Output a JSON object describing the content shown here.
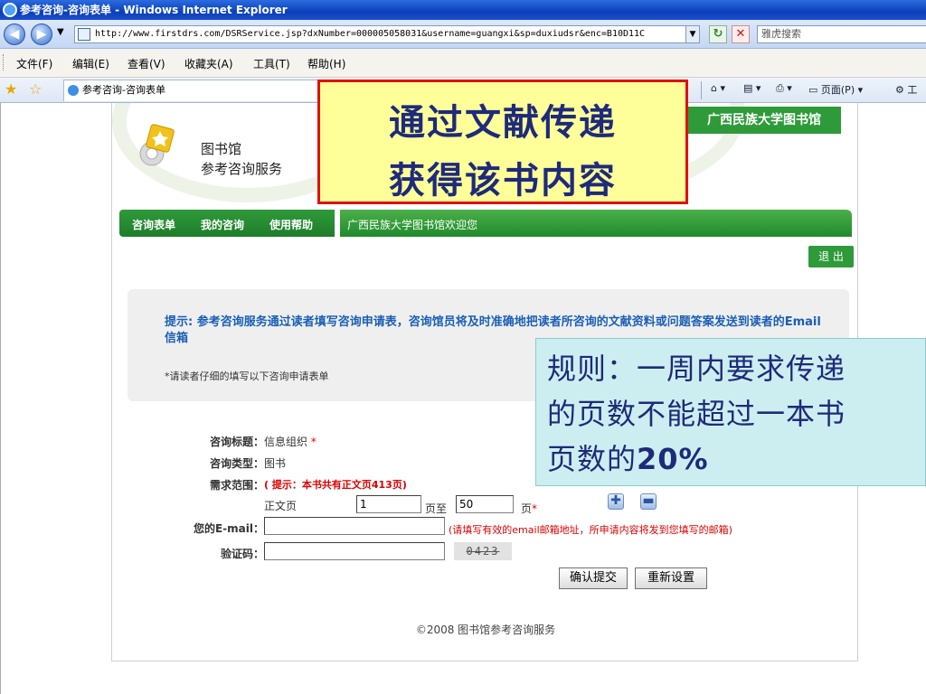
{
  "browser": {
    "window_title": "参考咨询-咨询表单 - Windows Internet Explorer",
    "url": "http://www.firstdrs.com/DSRService.jsp?dxNumber=000005058031&username=guangxi&sp=duxiudsr&enc=B10D11C",
    "search_placeholder": "雅虎搜索",
    "menu": [
      "文件(F)",
      "编辑(E)",
      "查看(V)",
      "收藏夹(A)",
      "工具(T)",
      "帮助(H)"
    ],
    "tab_title": "参考咨询-咨询表单",
    "cmd_page": "页面(P)",
    "cmd_tools": "工"
  },
  "page": {
    "brand_line1": "图书馆",
    "brand_line2": "参考咨询服务",
    "university_banner": "广西民族大学图书馆",
    "nav_tabs": [
      "咨询表单",
      "我的咨询",
      "使用帮助"
    ],
    "welcome": "广西民族大学图书馆欢迎您",
    "logout": "退 出",
    "notice": "提示: 参考咨询服务通过读者填写咨询申请表，咨询馆员将及时准确地把读者所咨询的文献资料或问题答案发送到读者的Email信箱",
    "notice_sub": "*请读者仔细的填写以下咨询申请表单",
    "form": {
      "title_label": "咨询标题：",
      "title_value": "信息组织",
      "title_required": "*",
      "type_label": "咨询类型：",
      "type_value": "图书",
      "range_label": "需求范围：",
      "range_hint": "( 提示：本书共有正文页413页)",
      "range_text": "正文页",
      "range_from": "1",
      "range_to_label": "页至",
      "range_to": "50",
      "range_page_label": "页",
      "range_required": "*",
      "email_label": "您的E-mail：",
      "email_value": "",
      "email_hint": "(请填写有效的email邮箱地址，所申请内容将发到您填写的邮箱)",
      "captcha_label": "验证码：",
      "captcha_value": "",
      "captcha_image_text": "0423",
      "submit": "确认提交",
      "reset": "重新设置"
    },
    "footer": "©2008 图书馆参考咨询服务"
  },
  "annotations": {
    "yellow_line1": "通过文献传递",
    "yellow_line2": "获得该书内容",
    "blue_line1": "规则：一周内要求传递",
    "blue_line2": "的页数不能超过一本书",
    "blue_line3_prefix": "页数的",
    "blue_line3_bold": "20%"
  }
}
